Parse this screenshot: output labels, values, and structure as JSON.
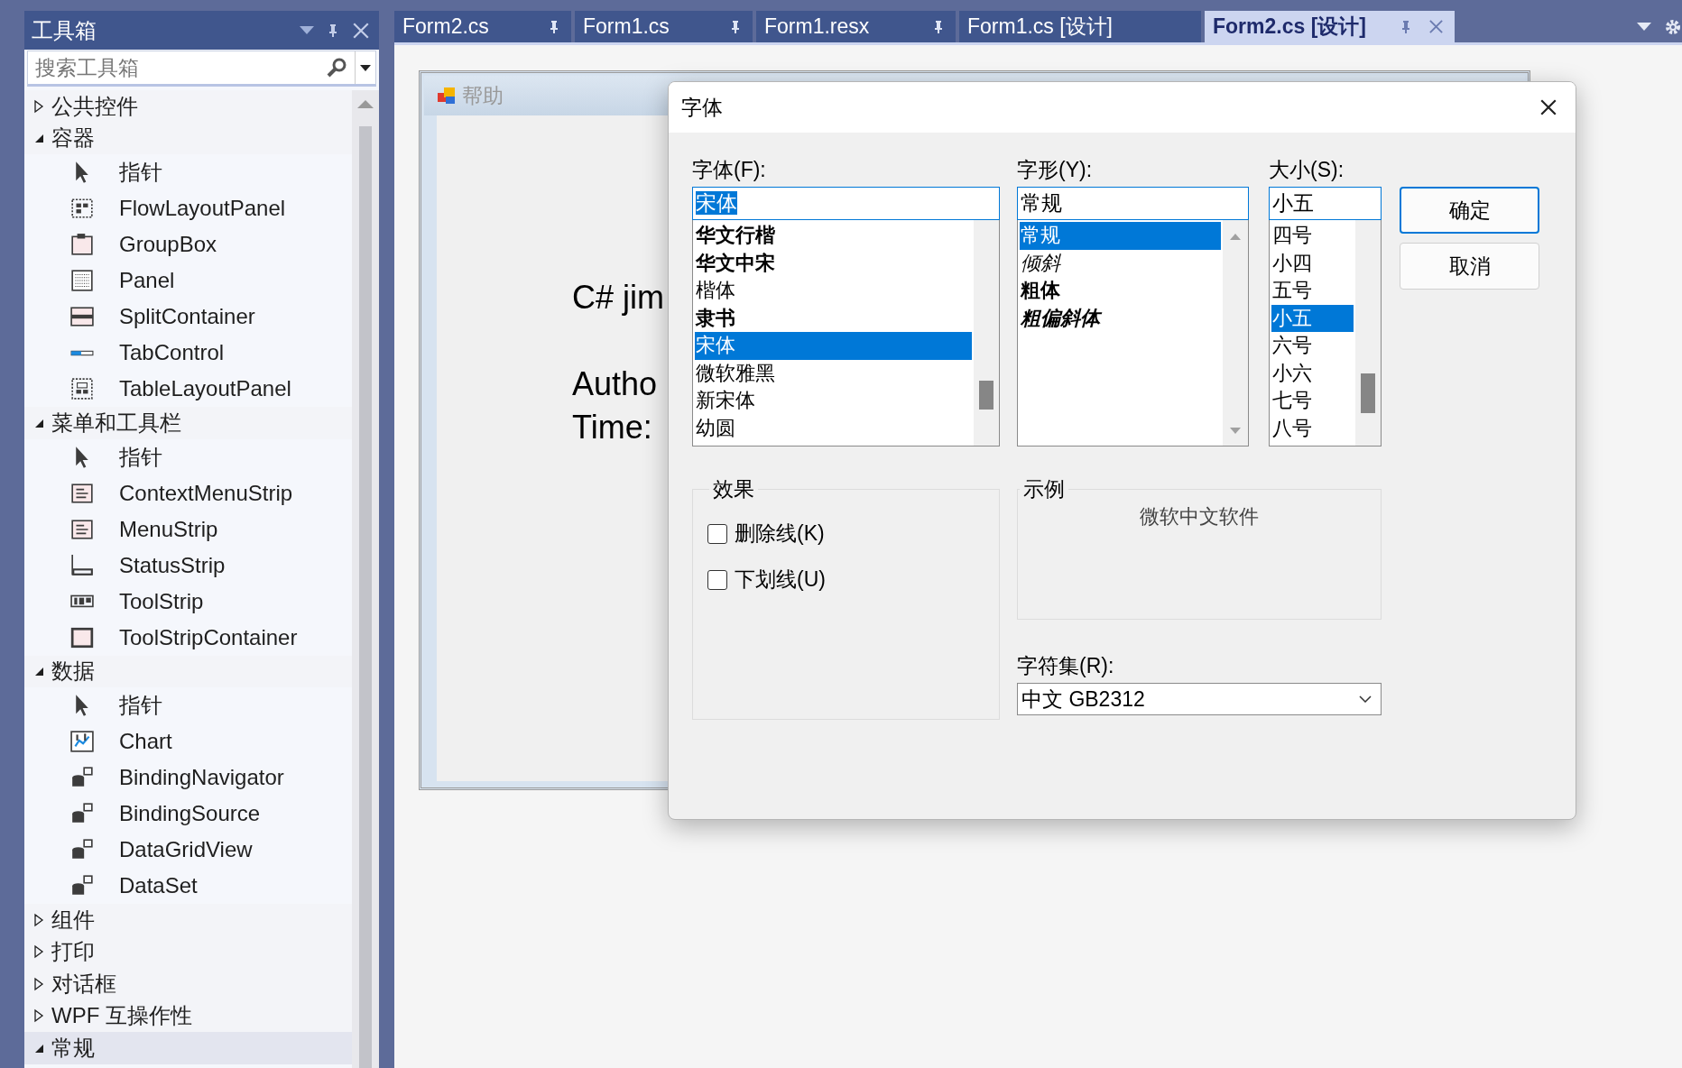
{
  "toolbox": {
    "title": "工具箱",
    "search": {
      "placeholder": "搜索工具箱"
    },
    "categories": [
      {
        "label": "公共控件",
        "expanded": false,
        "selected": false
      },
      {
        "label": "容器",
        "expanded": true,
        "selected": false,
        "items": [
          "指针",
          "FlowLayoutPanel",
          "GroupBox",
          "Panel",
          "SplitContainer",
          "TabControl",
          "TableLayoutPanel"
        ]
      },
      {
        "label": "菜单和工具栏",
        "expanded": true,
        "selected": false,
        "items": [
          "指针",
          "ContextMenuStrip",
          "MenuStrip",
          "StatusStrip",
          "ToolStrip",
          "ToolStripContainer"
        ]
      },
      {
        "label": "数据",
        "expanded": true,
        "selected": false,
        "items": [
          "指针",
          "Chart",
          "BindingNavigator",
          "BindingSource",
          "DataGridView",
          "DataSet"
        ]
      },
      {
        "label": "组件",
        "expanded": false,
        "selected": false
      },
      {
        "label": "打印",
        "expanded": false,
        "selected": false
      },
      {
        "label": "对话框",
        "expanded": false,
        "selected": false
      },
      {
        "label": "WPF 互操作性",
        "expanded": false,
        "selected": false
      },
      {
        "label": "常规",
        "expanded": true,
        "selected": true
      }
    ]
  },
  "tabs": [
    {
      "label": "Form2.cs",
      "selected": false,
      "pinned": true
    },
    {
      "label": "Form1.cs",
      "selected": false,
      "pinned": true
    },
    {
      "label": "Form1.resx",
      "selected": false,
      "pinned": true
    },
    {
      "label": "Form1.cs [设计]",
      "selected": false,
      "pinned": false
    },
    {
      "label": "Form2.cs [设计]",
      "selected": true,
      "pinned": true
    }
  ],
  "designer": {
    "form": {
      "title": "帮助",
      "labels": [
        "C# jim",
        "Autho",
        "Time:"
      ]
    }
  },
  "font_dialog": {
    "title": "字体",
    "font": {
      "label": "字体(F):",
      "value": "宋体",
      "highlighted": true,
      "items": [
        {
          "label": "华文行楷",
          "kind": "bold",
          "selected": false
        },
        {
          "label": "华文中宋",
          "kind": "bold",
          "selected": false
        },
        {
          "label": "楷体",
          "kind": "regular",
          "selected": false
        },
        {
          "label": "隶书",
          "kind": "bold",
          "selected": false
        },
        {
          "label": "宋体",
          "kind": "regular",
          "selected": true
        },
        {
          "label": "微软雅黑",
          "kind": "regular",
          "selected": false
        },
        {
          "label": "新宋体",
          "kind": "regular",
          "selected": false
        },
        {
          "label": "幼圆",
          "kind": "regular",
          "selected": false
        }
      ]
    },
    "style": {
      "label": "字形(Y):",
      "value": "常规",
      "items": [
        {
          "label": "常规",
          "kind": "regular",
          "selected": true
        },
        {
          "label": "倾斜",
          "kind": "italic",
          "selected": false
        },
        {
          "label": "粗体",
          "kind": "bold",
          "selected": false
        },
        {
          "label": "粗偏斜体",
          "kind": "bolditalic",
          "selected": false
        }
      ]
    },
    "size": {
      "label": "大小(S):",
      "value": "小五",
      "items": [
        {
          "label": "四号",
          "selected": false
        },
        {
          "label": "小四",
          "selected": false
        },
        {
          "label": "五号",
          "selected": false
        },
        {
          "label": "小五",
          "selected": true
        },
        {
          "label": "六号",
          "selected": false
        },
        {
          "label": "小六",
          "selected": false
        },
        {
          "label": "七号",
          "selected": false
        },
        {
          "label": "八号",
          "selected": false
        }
      ]
    },
    "buttons": [
      {
        "label": "确定",
        "default": true
      },
      {
        "label": "取消",
        "default": false
      }
    ],
    "effects": {
      "label": "效果",
      "options": [
        {
          "label": "删除线(K)",
          "checked": false
        },
        {
          "label": "下划线(U)",
          "checked": false
        }
      ]
    },
    "sample": {
      "label": "示例",
      "text": "微软中文软件"
    },
    "charset": {
      "label": "字符集(R):",
      "value": "中文 GB2312"
    }
  }
}
